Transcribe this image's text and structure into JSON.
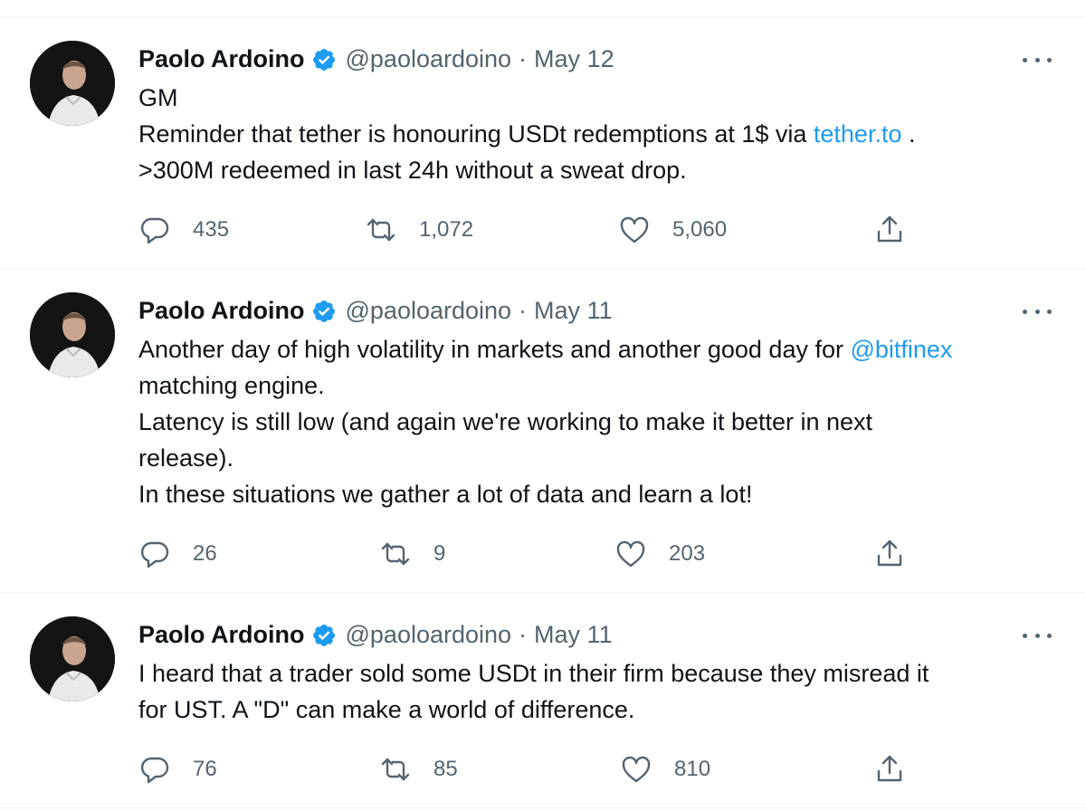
{
  "tweets": [
    {
      "name": "Paolo Ardoino",
      "handle": "@paoloardoino",
      "separator": "·",
      "date": "May 12",
      "lines": [
        {
          "text": "GM"
        },
        {
          "pre": "Reminder that tether is honouring USDt redemptions at 1$ via ",
          "link": "tether.to",
          "post": " ."
        },
        {
          "text": ">300M redeemed in last 24h without a sweat drop."
        }
      ],
      "replies": "435",
      "retweets": "1,072",
      "likes": "5,060"
    },
    {
      "name": "Paolo Ardoino",
      "handle": "@paoloardoino",
      "separator": "·",
      "date": "May 11",
      "lines": [
        {
          "pre": "Another day of high volatility in markets and another good day for ",
          "link": "@bitfinex"
        },
        {
          "text": "matching engine."
        },
        {
          "text": "Latency is still low (and again we're working to make it better in next"
        },
        {
          "text": "release)."
        },
        {
          "text": "In these situations we gather a lot of data and learn a lot!"
        }
      ],
      "replies": "26",
      "retweets": "9",
      "likes": "203"
    },
    {
      "name": "Paolo Ardoino",
      "handle": "@paoloardoino",
      "separator": "·",
      "date": "May 11",
      "lines": [
        {
          "text": "I heard that a trader sold some USDt in their firm because they misread it"
        },
        {
          "text": "for UST. A \"D\" can make a world of difference."
        }
      ],
      "replies": "76",
      "retweets": "85",
      "likes": "810"
    }
  ],
  "icons": {
    "reply": "reply-icon",
    "retweet": "retweet-icon",
    "like": "heart-icon",
    "share": "share-icon",
    "verified": "verified-badge-icon",
    "more": "more-options-icon"
  },
  "colors": {
    "link": "#1d9bf0",
    "verified": "#1d9bf0",
    "secondary_text": "#536471"
  }
}
